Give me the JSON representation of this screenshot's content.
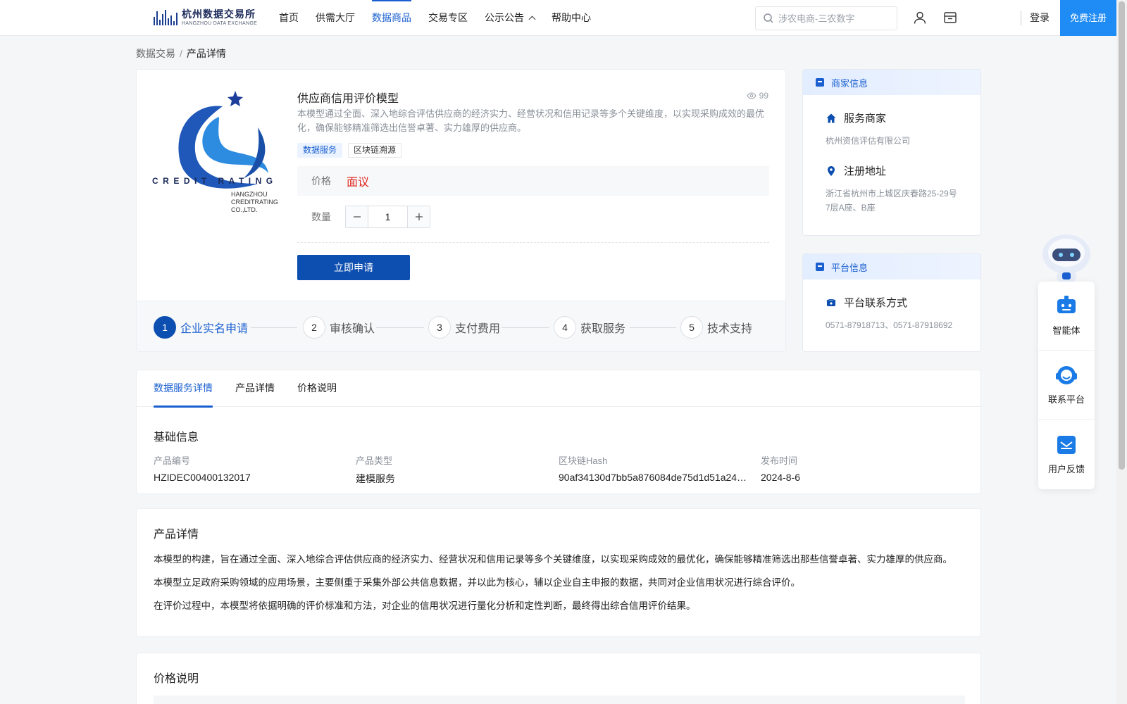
{
  "header": {
    "logo_cn": "杭州数据交易所",
    "logo_en": "HANGZHOU DATA EXCHANGE",
    "nav": [
      {
        "label": "首页",
        "active": false
      },
      {
        "label": "供需大厅",
        "active": false
      },
      {
        "label": "数据商品",
        "active": true
      },
      {
        "label": "交易专区",
        "active": false
      },
      {
        "label": "公示公告",
        "active": false,
        "has_dropdown": true
      },
      {
        "label": "帮助中心",
        "active": false
      }
    ],
    "search_placeholder": "涉农电商-三农数字",
    "login_label": "登录",
    "register_label": "免费注册"
  },
  "breadcrumb": {
    "parent": "数据交易",
    "separator": "/",
    "current": "产品详情"
  },
  "product": {
    "logo_text": "CREDIT RATING",
    "logo_sub_1": "HANGZHOU",
    "logo_sub_2": "CREDITRATING",
    "logo_sub_3": "CO.,LTD.",
    "title": "供应商信用评价模型",
    "views": "99",
    "description": "本模型通过全面、深入地综合评估供应商的经济实力、经营状况和信用记录等多个关键维度，以实现采购成效的最优化，确保能够精准筛选出信誉卓著、实力雄厚的供应商。",
    "tags": [
      "数据服务",
      "区块链溯源"
    ],
    "price_label": "价格",
    "price_value": "面议",
    "quantity_label": "数量",
    "quantity_value": "1",
    "apply_label": "立即申请",
    "steps": [
      {
        "num": "1",
        "label": "企业实名申请",
        "active": true
      },
      {
        "num": "2",
        "label": "审核确认",
        "active": false
      },
      {
        "num": "3",
        "label": "支付费用",
        "active": false
      },
      {
        "num": "4",
        "label": "获取服务",
        "active": false
      },
      {
        "num": "5",
        "label": "技术支持",
        "active": false
      }
    ]
  },
  "merchant": {
    "header": "商家信息",
    "service_title": "服务商家",
    "service_value": "杭州资信评估有限公司",
    "address_title": "注册地址",
    "address_value": "浙江省杭州市上城区庆春路25-29号7层A座、B座"
  },
  "platform": {
    "header": "平台信息",
    "contact_title": "平台联系方式",
    "contact_value": "0571-87918713、0571-87918692"
  },
  "float_panel": {
    "items": [
      "智能体",
      "联系平台",
      "用户反馈"
    ]
  },
  "tabs": [
    {
      "label": "数据服务详情",
      "active": true
    },
    {
      "label": "产品详情",
      "active": false
    },
    {
      "label": "价格说明",
      "active": false
    }
  ],
  "basic_info": {
    "title": "基础信息",
    "fields": [
      {
        "label": "产品编号",
        "value": "HZIDEC00400132017"
      },
      {
        "label": "产品类型",
        "value": "建模服务"
      },
      {
        "label": "区块链Hash",
        "value": "90af34130d7bb5a876084de75d1d51a24e..."
      },
      {
        "label": "发布时间",
        "value": "2024-8-6"
      }
    ]
  },
  "product_detail": {
    "title": "产品详情",
    "paragraphs": [
      "本模型的构建，旨在通过全面、深入地综合评估供应商的经济实力、经营状况和信用记录等多个关键维度，以实现采购成效的最优化，确保能够精准筛选出那些信誉卓著、实力雄厚的供应商。",
      "本模型立足政府采购领域的应用场景，主要侧重于采集外部公共信息数据，并以此为核心，辅以企业自主申报的数据，共同对企业信用状况进行综合评价。",
      "在评价过程中，本模型将依据明确的评价标准和方法，对企业的信用状况进行量化分析和定性判断，最终得出综合信用评价结果。"
    ]
  },
  "price_section": {
    "title": "价格说明"
  },
  "colors": {
    "primary": "#1a5fd0",
    "primary_dark": "#0d4fb0",
    "register_bg": "#1f8bf4",
    "price_red": "#e0251b"
  }
}
